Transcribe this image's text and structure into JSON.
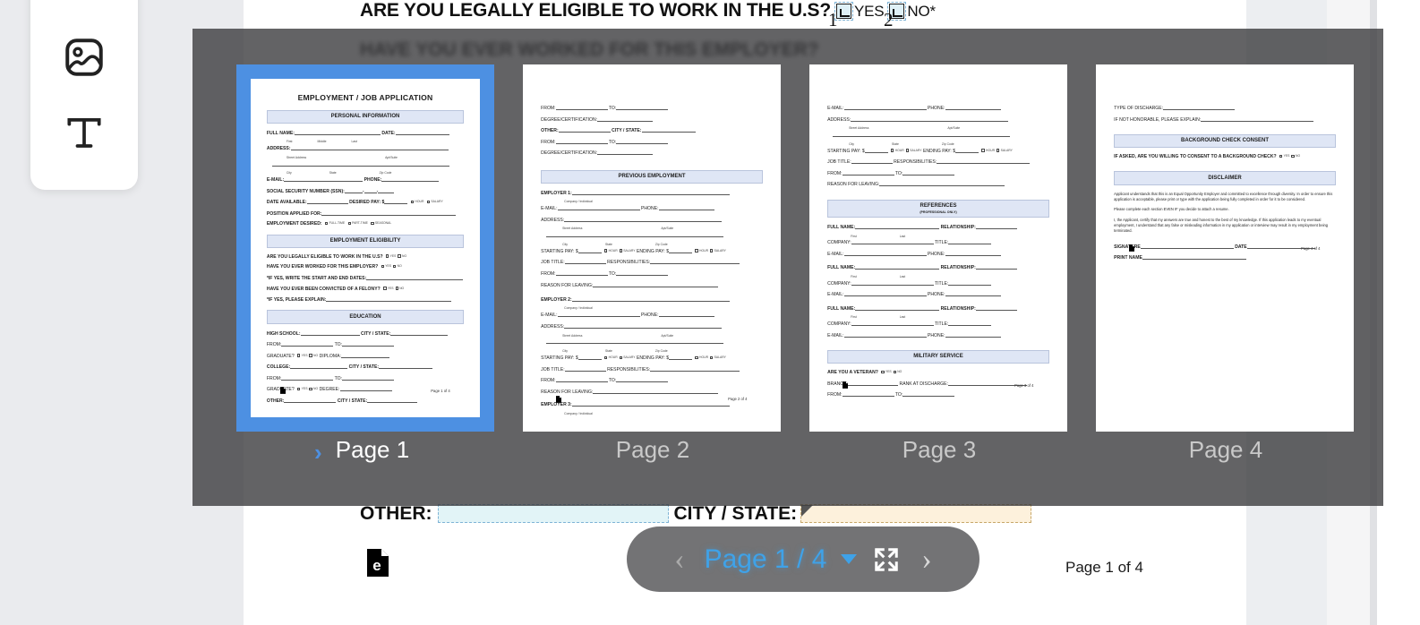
{
  "app": {
    "viewer_page_indicator": "Page 1 of 4",
    "accent_color": "#4d90e2",
    "toolbar_page_color": "#3fa2e8",
    "overlay_color": "#3c3c3e"
  },
  "tools": {
    "image_tool": {
      "name": "image-tool",
      "icon": "image-icon"
    },
    "text_tool": {
      "name": "text-tool",
      "icon": "text-t-icon"
    }
  },
  "document_background": {
    "question": "ARE YOU LEGALLY ELIGIBLE TO WORK IN THE U.S?",
    "yes_label": "YES",
    "no_label": "NO*",
    "field_number_1": "1",
    "field_number_2": "2",
    "blurred_question": "HAVE YOU EVER WORKED FOR THIS EMPLOYER?",
    "other_label": "OTHER:",
    "city_state_label": "CITY / STATE:",
    "logo_letter": "e"
  },
  "thumbnail_strip": {
    "pages": [
      {
        "label": "Page 1",
        "selected": true,
        "marker": "›"
      },
      {
        "label": "Page 2",
        "selected": false,
        "marker": ""
      },
      {
        "label": "Page 3",
        "selected": false,
        "marker": ""
      },
      {
        "label": "Page 4",
        "selected": false,
        "marker": ""
      }
    ]
  },
  "toolbar": {
    "prev_label": "‹",
    "next_label": "›",
    "page_indicator": "Page 1 / 4",
    "fullscreen_icon": "fullscreen-expand-icon",
    "dropdown_icon": "chevron-down-icon"
  },
  "page1": {
    "title": "EMPLOYMENT / JOB APPLICATION",
    "section_personal": "PERSONAL INFORMATION",
    "section_eligibility": "EMPLOYMENT ELIGIBILITY",
    "section_education": "EDUCATION",
    "rows": [
      "FULL NAME:",
      "DATE:",
      "ADDRESS:",
      "E-MAIL:",
      "PHONE:",
      "SOCIAL SECURITY NUMBER (SSN):",
      "DATE AVAILABLE:",
      "DESIRED PAY: $",
      "POSITION APPLIED FOR:",
      "EMPLOYMENT DESIRED:"
    ],
    "sub_labels": [
      "First",
      "Middle",
      "Last",
      "Street Address",
      "Apt/Suite",
      "City",
      "State",
      "Zip Code"
    ],
    "pay_options": [
      "HOUR",
      "SALARY"
    ],
    "employment_options": [
      "FULL-TIME",
      "PART-TIME",
      "SEASONAL"
    ],
    "eligibility_questions": [
      "ARE YOU LEGALLY ELIGIBLE TO WORK IN THE U.S?",
      "HAVE YOU EVER WORKED FOR THIS EMPLOYER?",
      "*IF YES, WRITE THE START AND END DATES:",
      "HAVE YOU EVER BEEN CONVICTED OF A FELONY?",
      "*IF YES, PLEASE EXPLAIN:"
    ],
    "education_rows": [
      "HIGH SCHOOL:",
      "CITY / STATE:",
      "FROM:",
      "TO:",
      "GRADUATE?",
      "DIPLOMA:",
      "COLLEGE:",
      "DEGREE:",
      "OTHER:"
    ],
    "footer": "Page 1 of 4"
  },
  "page2": {
    "section_previous_employment": "PREVIOUS EMPLOYMENT",
    "top_rows": [
      "FROM:",
      "TO:",
      "DEGREE/CERTIFICATION:",
      "OTHER:",
      "CITY / STATE:"
    ],
    "employer_labels": [
      "EMPLOYER 1:",
      "EMPLOYER 2:",
      "EMPLOYER 3:"
    ],
    "sub_company": "Company / Individual",
    "rows": [
      "E-MAIL:",
      "PHONE:",
      "ADDRESS:",
      "STARTING PAY: $",
      "ENDING PAY: $",
      "JOB TITLE:",
      "RESPONSIBILITIES:",
      "REASON FOR LEAVING:"
    ],
    "footer": "Page 2 of 4"
  },
  "page3": {
    "section_references": "REFERENCES",
    "section_references_sub": "(PROFESSIONAL ONLY)",
    "section_military": "MILITARY SERVICE",
    "rows": [
      "E-MAIL:",
      "PHONE:",
      "ADDRESS:",
      "STARTING PAY: $",
      "ENDING PAY: $",
      "JOB TITLE:",
      "RESPONSIBILITIES:",
      "FROM:",
      "TO:",
      "REASON FOR LEAVING:"
    ],
    "reference_rows": [
      "FULL NAME:",
      "RELATIONSHIP:",
      "COMPANY:",
      "TITLE:",
      "E-MAIL:",
      "PHONE:"
    ],
    "military_rows": [
      "ARE YOU A VETERAN?",
      "BRANCH:",
      "RANK AT DISCHARGE:",
      "FROM:",
      "TO:"
    ],
    "footer": "Page 3 of 4"
  },
  "page4": {
    "section_background": "BACKGROUND CHECK CONSENT",
    "section_disclaimer": "DISCLAIMER",
    "rows": [
      "TYPE OF DISCHARGE:",
      "IF NOT HONORABLE, PLEASE EXPLAIN:"
    ],
    "consent_question": "IF ASKED, ARE YOU WILLING TO CONSENT TO A BACKGROUND CHECK?",
    "paragraphs": [
      "Applicant understands that this is an Equal Opportunity Employer and committed to excellence through diversity. In order to ensure this application is acceptable, please print or type with the application being fully completed in order for it to be considered.",
      "Please complete each section EVEN IF you decide to attach a resume.",
      "I, the Applicant, certify that my answers are true and honest to the best of my knowledge. If this application leads to my eventual employment, I understand that any false or misleading information in my application or interview may result in my employment being terminated."
    ],
    "signature_rows": [
      "SIGNATURE",
      "DATE",
      "PRINT NAME"
    ],
    "footer": "Page 4 of 4"
  },
  "yes_no": {
    "yes": "YES",
    "no": "NO"
  }
}
